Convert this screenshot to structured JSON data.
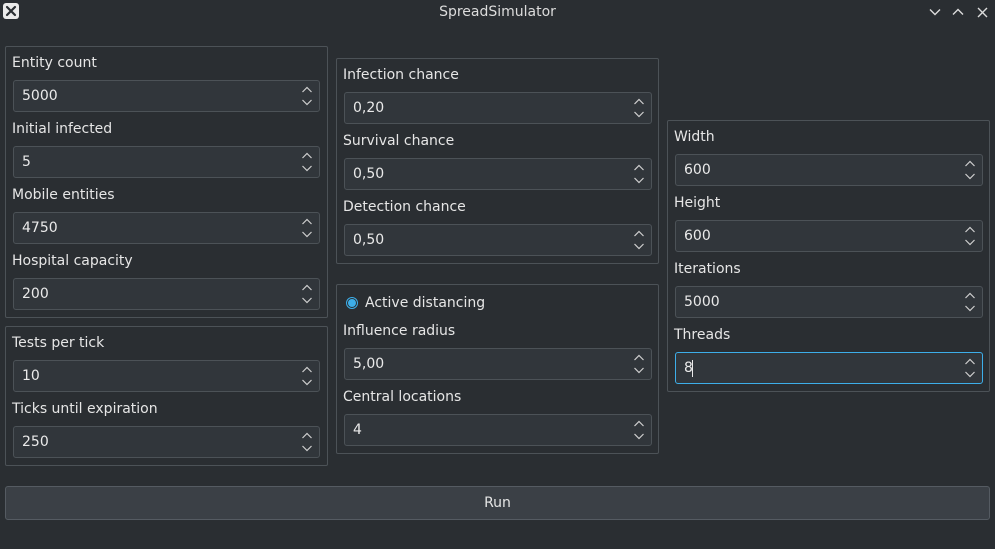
{
  "window": {
    "title": "SpreadSimulator",
    "controls": [
      "minimize-icon",
      "maximize-icon",
      "close-icon"
    ]
  },
  "population_group": {
    "entity_count_label": "Entity count",
    "entity_count_value": "5000",
    "initial_infected_label": "Initial infected",
    "initial_infected_value": "5",
    "mobile_entities_label": "Mobile entities",
    "mobile_entities_value": "4750",
    "hospital_capacity_label": "Hospital capacity",
    "hospital_capacity_value": "200"
  },
  "testing_group": {
    "tests_per_tick_label": "Tests per tick",
    "tests_per_tick_value": "10",
    "ticks_until_expiration_label": "Ticks until expiration",
    "ticks_until_expiration_value": "250"
  },
  "chance_group": {
    "infection_chance_label": "Infection chance",
    "infection_chance_value": "0,20",
    "survival_chance_label": "Survival chance",
    "survival_chance_value": "0,50",
    "detection_chance_label": "Detection chance",
    "detection_chance_value": "0,50"
  },
  "distancing_group": {
    "active_distancing_label": "Active distancing",
    "active_distancing_checked": true,
    "influence_radius_label": "Influence radius",
    "influence_radius_value": "5,00",
    "central_locations_label": "Central locations",
    "central_locations_value": "4"
  },
  "simulation_group": {
    "width_label": "Width",
    "width_value": "600",
    "height_label": "Height",
    "height_value": "600",
    "iterations_label": "Iterations",
    "iterations_value": "5000",
    "threads_label": "Threads",
    "threads_value": "8"
  },
  "run_button_label": "Run",
  "colors": {
    "background": "#2a2e32",
    "field": "#31363b",
    "border": "#4c5257",
    "accent": "#3daee9"
  }
}
